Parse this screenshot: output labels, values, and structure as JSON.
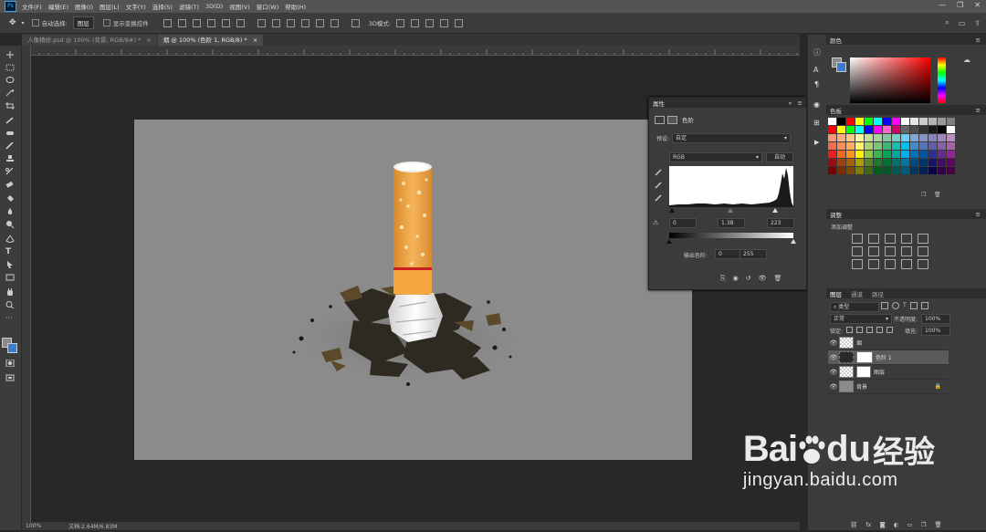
{
  "menubar": {
    "logo": "Ps",
    "items": [
      "文件(F)",
      "编辑(E)",
      "图像(I)",
      "图层(L)",
      "文字(Y)",
      "选择(S)",
      "滤镜(T)",
      "3D(D)",
      "视图(V)",
      "窗口(W)",
      "帮助(H)"
    ],
    "window_buttons": [
      "—",
      "❐",
      "✕"
    ]
  },
  "options": {
    "auto_select_label": "自动选择:",
    "auto_select_value": "图层",
    "show_transform_label": "显示变换控件",
    "mode_3d": "3D模式:"
  },
  "tabs": [
    {
      "label": "人像精修.psd @ 100% (背景, RGB/8#) *",
      "close": "×"
    },
    {
      "label": "烟 @ 100% (色阶 1, RGB/8) *",
      "close": "×"
    }
  ],
  "status": {
    "zoom": "100%",
    "doc": "文档:2.64M/6.83M"
  },
  "properties": {
    "title": "属性",
    "section": "色阶",
    "preset_label": "预设:",
    "preset_value": "自定",
    "channel": "RGB",
    "auto_button": "自动",
    "input_black": "0",
    "input_gamma": "1.38",
    "input_white": "223",
    "output_label": "输出色阶:",
    "output_black": "0",
    "output_white": "255",
    "expand_icon": "»",
    "menu_icon": "≡"
  },
  "color_panel": {
    "title": "颜色"
  },
  "swatches_panel": {
    "title": "色板",
    "colors": [
      "#ffffff",
      "#000000",
      "#ff0000",
      "#ffff00",
      "#00ff00",
      "#00ffff",
      "#0000ff",
      "#ff00ff",
      "#ffffff",
      "#e6e6e6",
      "#cccccc",
      "#b3b3b3",
      "#999999",
      "#808080",
      "#ff0000",
      "#ffff00",
      "#00ff00",
      "#00ffff",
      "#0000ff",
      "#ff00ff",
      "#ff66cc",
      "#cc0066",
      "#666666",
      "#4d4d4d",
      "#333333",
      "#1a1a1a",
      "#000000",
      "#ffffff",
      "#f7977a",
      "#f9ad81",
      "#fdc68a",
      "#fff79a",
      "#c4df9b",
      "#a3d39c",
      "#82ca9d",
      "#7bcdc8",
      "#6ecff6",
      "#7ea7d8",
      "#8493ca",
      "#8882be",
      "#a187be",
      "#bc8dbf",
      "#f26c4f",
      "#f68e55",
      "#fbaf5c",
      "#fff467",
      "#acd372",
      "#7cc576",
      "#3bb878",
      "#1abbb4",
      "#00bff3",
      "#438cca",
      "#5574b9",
      "#605ca8",
      "#855fa8",
      "#a763a8",
      "#ed1c24",
      "#f26522",
      "#f7941d",
      "#fff200",
      "#8dc73f",
      "#39b54a",
      "#00a651",
      "#00a99d",
      "#00aeef",
      "#0072bc",
      "#0054a6",
      "#2e3192",
      "#662d91",
      "#92278f",
      "#9e0b0f",
      "#a0410d",
      "#a36209",
      "#aba000",
      "#598527",
      "#1a7b30",
      "#007236",
      "#00746b",
      "#0076a3",
      "#004b80",
      "#003471",
      "#1b1464",
      "#440e62",
      "#630460",
      "#790000",
      "#7b2e00",
      "#7d4900",
      "#827b00",
      "#406618",
      "#005e20",
      "#005826",
      "#005952",
      "#005b7f",
      "#003663",
      "#002157",
      "#0d004c",
      "#32004b",
      "#4b0049"
    ],
    "menu_icon": "≡"
  },
  "adjustments_panel": {
    "title": "调整",
    "add_label": "添加调整"
  },
  "layers_panel": {
    "tabs": [
      "图层",
      "通道",
      "路径"
    ],
    "filter": "类型",
    "blend_mode": "正常",
    "opacity_label": "不透明度:",
    "opacity_value": "100%",
    "lock_label": "锁定:",
    "fill_label": "填充:",
    "fill_value": "100%",
    "layers": [
      {
        "name": "烟"
      },
      {
        "name": "色阶 1"
      },
      {
        "name": "图层"
      },
      {
        "name": "背景"
      }
    ],
    "eye_glyph": "👁"
  },
  "icon_strip": [
    {
      "glyph": "ⓘ",
      "name": "info-icon"
    },
    {
      "glyph": "A",
      "name": "character-icon"
    },
    {
      "glyph": "¶",
      "name": "paragraph-icon"
    },
    {
      "glyph": "◉",
      "name": "properties-icon"
    },
    {
      "glyph": "⊞",
      "name": "libraries-icon"
    },
    {
      "glyph": "▶",
      "name": "play-icon"
    }
  ],
  "watermark": {
    "brand_left": "Bai",
    "brand_right": "du",
    "paw": "🐾",
    "cn": "经验",
    "url": "jingyan.baidu.com"
  }
}
